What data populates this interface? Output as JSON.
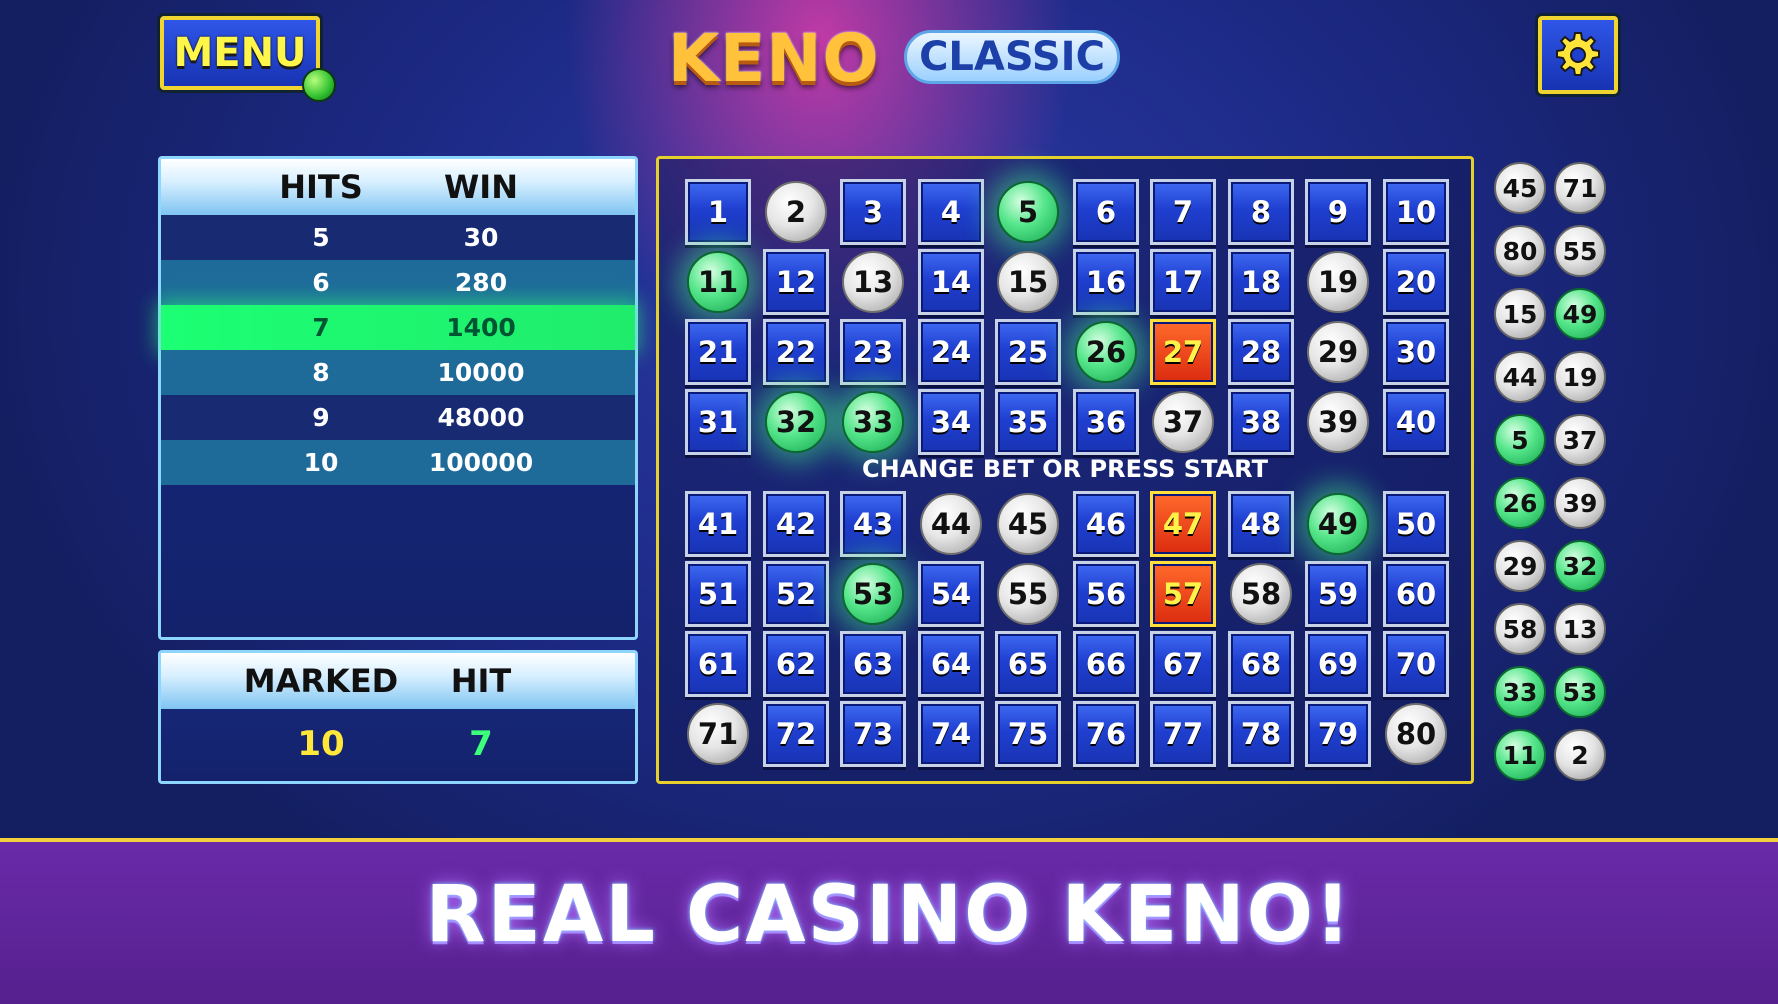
{
  "header": {
    "menu_label": "MENU",
    "logo_keno": "KENO",
    "logo_classic": "CLASSIC",
    "settings_icon": "gear-icon"
  },
  "paytable": {
    "col_hits": "HITS",
    "col_win": "WIN",
    "rows": [
      {
        "hits": "5",
        "win": "30"
      },
      {
        "hits": "6",
        "win": "280"
      },
      {
        "hits": "7",
        "win": "1400",
        "highlighted": true
      },
      {
        "hits": "8",
        "win": "10000"
      },
      {
        "hits": "9",
        "win": "48000"
      },
      {
        "hits": "10",
        "win": "100000"
      }
    ]
  },
  "stats": {
    "marked_label": "MARKED",
    "hit_label": "HIT",
    "marked_value": "10",
    "hit_value": "7"
  },
  "board": {
    "message": "CHANGE BET OR PRESS START",
    "hits": [
      5,
      11,
      26,
      32,
      33,
      49,
      53
    ],
    "drawn_misses": [
      2,
      13,
      15,
      19,
      29,
      37,
      39,
      44,
      45,
      55,
      58,
      71,
      80
    ],
    "red": [
      27,
      47,
      57
    ]
  },
  "drawn_balls": [
    {
      "n": "45"
    },
    {
      "n": "71"
    },
    {
      "n": "80"
    },
    {
      "n": "55"
    },
    {
      "n": "15"
    },
    {
      "n": "49",
      "hit": true
    },
    {
      "n": "44"
    },
    {
      "n": "19"
    },
    {
      "n": "5",
      "hit": true
    },
    {
      "n": "37"
    },
    {
      "n": "26",
      "hit": true
    },
    {
      "n": "39"
    },
    {
      "n": "29"
    },
    {
      "n": "32",
      "hit": true
    },
    {
      "n": "58"
    },
    {
      "n": "13"
    },
    {
      "n": "33",
      "hit": true
    },
    {
      "n": "53",
      "hit": true
    },
    {
      "n": "11",
      "hit": true
    },
    {
      "n": "2"
    }
  ],
  "tagline": "REAL CASINO KENO!",
  "colors": {
    "hit_green": "#55e58a",
    "frame_gold": "#f0d42f",
    "tile_blue": "#1f3fd0",
    "tile_red": "#dc2b10"
  }
}
